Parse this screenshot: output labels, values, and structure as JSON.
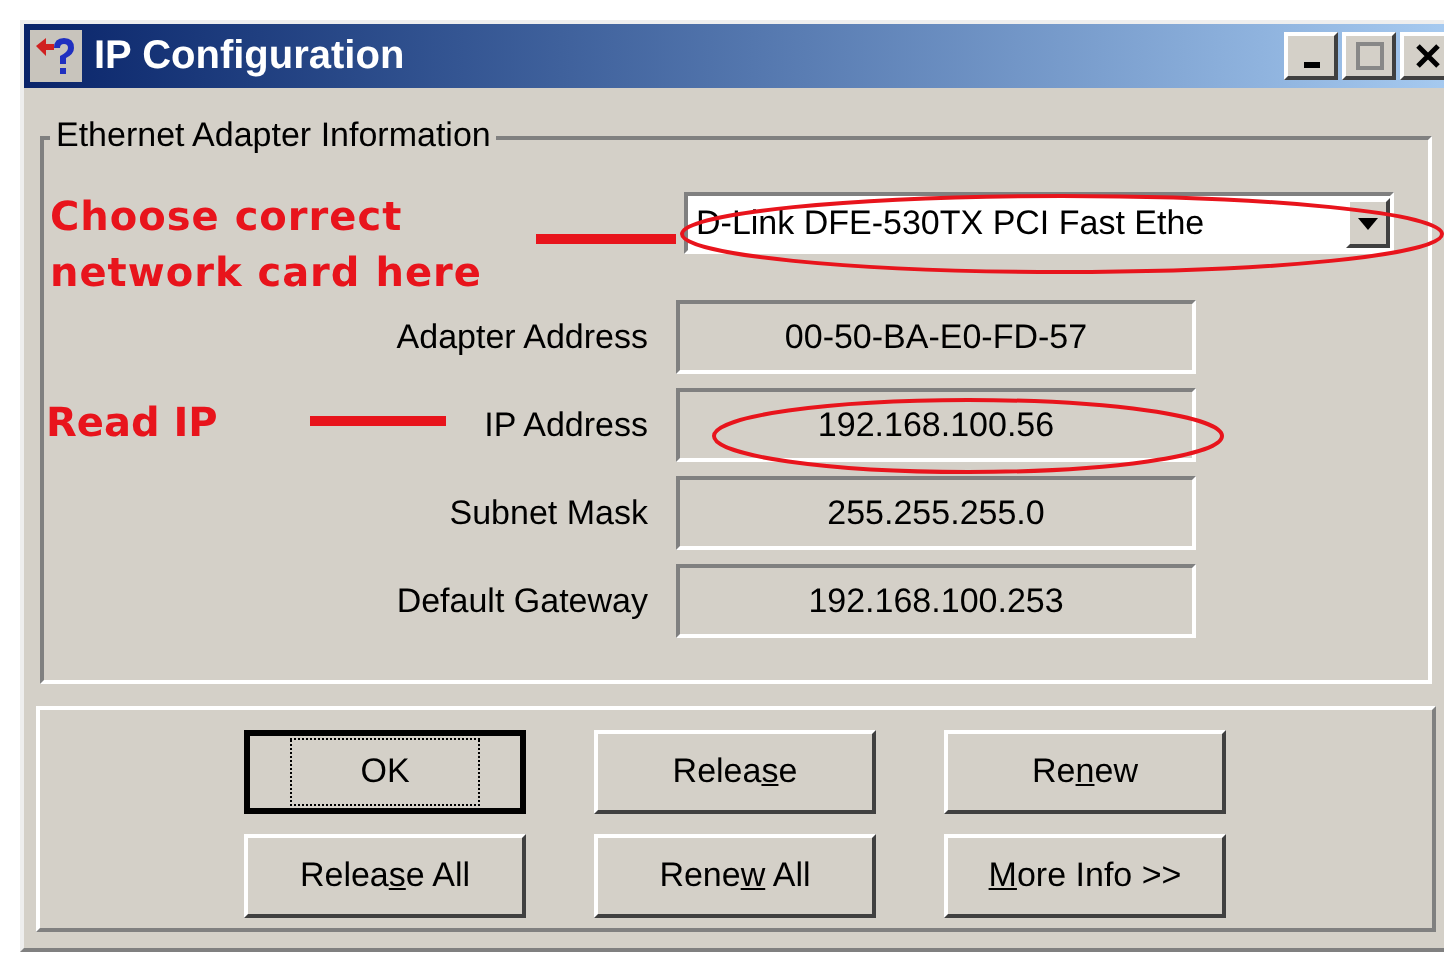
{
  "window": {
    "title": "IP Configuration"
  },
  "group": {
    "title": "Ethernet  Adapter Information"
  },
  "adapter_select": {
    "value": "D-Link DFE-530TX PCI Fast Ethe"
  },
  "fields": [
    {
      "label": "Adapter Address",
      "value": "00-50-BA-E0-FD-57"
    },
    {
      "label": "IP Address",
      "value": "192.168.100.56"
    },
    {
      "label": "Subnet Mask",
      "value": "255.255.255.0"
    },
    {
      "label": "Default Gateway",
      "value": "192.168.100.253"
    }
  ],
  "buttons": [
    {
      "key": "O",
      "after": "K",
      "default": true,
      "underlined": false
    },
    {
      "before": "Relea",
      "key": "s",
      "after": "e",
      "default": false,
      "underlined": true
    },
    {
      "before": "Re",
      "key": "n",
      "after": "ew",
      "default": false,
      "underlined": true
    },
    {
      "before": "Relea",
      "key": "s",
      "after": "e All",
      "default": false,
      "underlined": true
    },
    {
      "before": "Rene",
      "key": "w",
      "after": " All",
      "default": false,
      "underlined": true
    },
    {
      "key": "M",
      "after": "ore Info >>",
      "default": false,
      "underlined": true
    }
  ],
  "annotations": [
    {
      "kind": "choose",
      "text": "Choose correct network card here"
    },
    {
      "kind": "read",
      "text": "Read IP"
    }
  ]
}
